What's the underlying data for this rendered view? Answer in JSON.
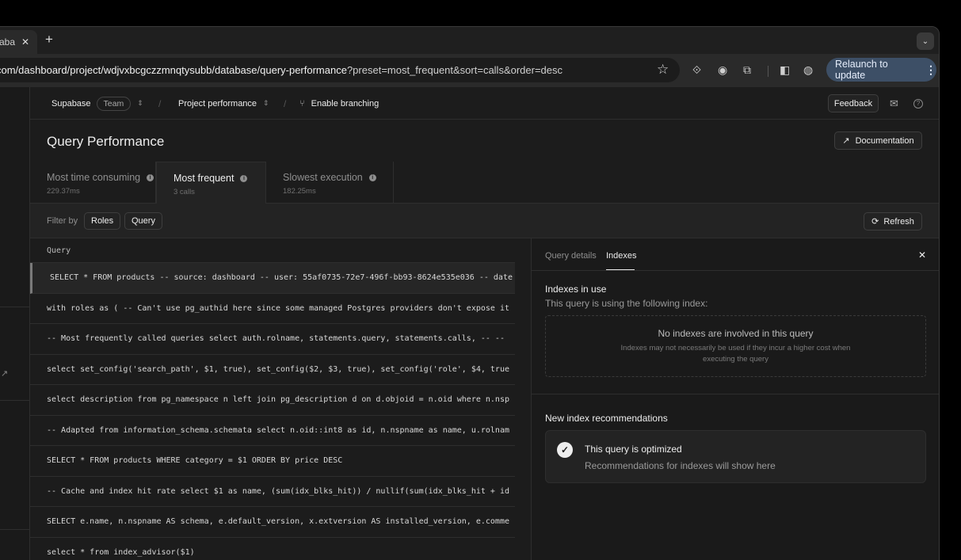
{
  "browser": {
    "tab_title": "aba",
    "tab_close": "✕",
    "new_tab": "+",
    "url_host": "com/dashboard/project/wdjvxbcgczzmnqtysubb/database/query-performance",
    "url_rest": "?preset=most_frequent&sort=calls&order=desc",
    "relaunch_label": "Relaunch to update"
  },
  "topbar": {
    "org": "Supabase",
    "plan": "Team",
    "project": "Project performance",
    "branching": "Enable branching",
    "feedback": "Feedback"
  },
  "page": {
    "title": "Query Performance",
    "documentation": "Documentation"
  },
  "metric_tabs": [
    {
      "label": "Most time consuming",
      "value": "229.37ms"
    },
    {
      "label": "Most frequent",
      "value": "3 calls"
    },
    {
      "label": "Slowest execution",
      "value": "182.25ms"
    }
  ],
  "filter": {
    "label": "Filter by",
    "roles": "Roles",
    "query": "Query",
    "refresh": "Refresh"
  },
  "table": {
    "header": "Query",
    "rows": [
      "SELECT * FROM products -- source: dashboard -- user: 55af0735-72e7-496f-bb93-8624e535e036 -- date",
      "with roles as ( -- Can't use pg_authid here since some managed Postgres providers don't expose it",
      "-- Most frequently called queries select auth.rolname, statements.query, statements.calls, -- --",
      "select set_config('search_path', $1, true), set_config($2, $3, true), set_config('role', $4, true",
      "select description from pg_namespace n left join pg_description d on d.objoid = n.oid where n.nsp",
      "-- Adapted from information_schema.schemata select n.oid::int8 as id, n.nspname as name, u.rolnam",
      "SELECT * FROM products WHERE category = $1 ORDER BY price DESC",
      "-- Cache and index hit rate select $1 as name, (sum(idx_blks_hit)) / nullif(sum(idx_blks_hit + id",
      "SELECT e.name, n.nspname AS schema, e.default_version, x.extversion AS installed_version, e.comme",
      "select * from index_advisor($1)"
    ]
  },
  "panel": {
    "tab_details": "Query details",
    "tab_indexes": "Indexes",
    "indexes_in_use": "Indexes in use",
    "indexes_sub": "This query is using the following index:",
    "empty_title": "No indexes are involved in this query",
    "empty_desc": "Indexes may not necessarily be used if they incur a higher cost when executing the query",
    "recommend_title": "New index recommendations",
    "optimized_title": "This query is optimized",
    "optimized_desc": "Recommendations for indexes will show here"
  }
}
